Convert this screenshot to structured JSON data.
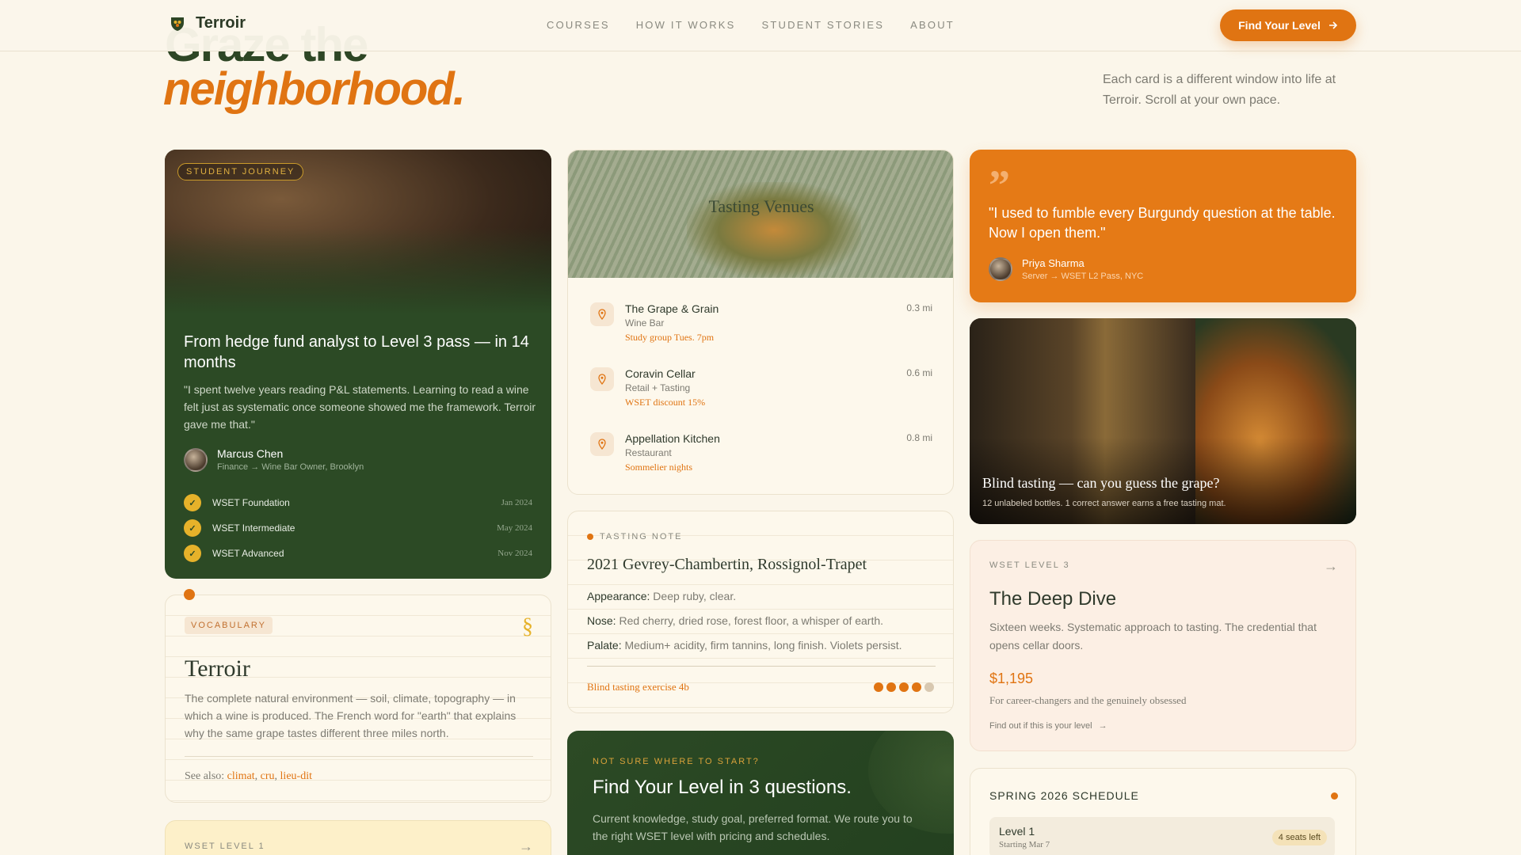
{
  "nav": {
    "brand": "Terroir",
    "links": [
      "COURSES",
      "HOW IT WORKS",
      "STUDENT STORIES",
      "ABOUT"
    ],
    "cta": "Find Your Level"
  },
  "hero": {
    "line1": "Graze the",
    "line2": "neighborhood.",
    "description": "Each card is a different window into life at Terroir. Scroll at your own pace."
  },
  "journey": {
    "badge": "STUDENT JOURNEY",
    "title": "From hedge fund analyst to Level 3 pass — in 14 months",
    "quote": "\"I spent twelve years reading P&L statements. Learning to read a wine felt just as systematic once someone showed me the framework. Terroir gave me that.\"",
    "person_name": "Marcus Chen",
    "person_role": "Finance → Wine Bar Owner, Brooklyn",
    "milestones": [
      {
        "label": "WSET Foundation",
        "date": "Jan 2024"
      },
      {
        "label": "WSET Intermediate",
        "date": "May 2024"
      },
      {
        "label": "WSET Advanced",
        "date": "Nov 2024"
      }
    ]
  },
  "venues": {
    "title": "Tasting Venues",
    "items": [
      {
        "name": "The Grape & Grain",
        "type": "Wine Bar",
        "note": "Study group Tues. 7pm",
        "distance": "0.3 mi"
      },
      {
        "name": "Coravin Cellar",
        "type": "Retail + Tasting",
        "note": "WSET discount 15%",
        "distance": "0.6 mi"
      },
      {
        "name": "Appellation Kitchen",
        "type": "Restaurant",
        "note": "Sommelier nights",
        "distance": "0.8 mi"
      }
    ]
  },
  "quote_card": {
    "mark": "”",
    "text": "\"I used to fumble every Burgundy question at the table. Now I open them.\"",
    "person_name": "Priya Sharma",
    "person_role": "Server → WSET L2 Pass, NYC"
  },
  "blind": {
    "title": "Blind tasting — can you guess the grape?",
    "subtitle": "12 unlabeled bottles. 1 correct answer earns a free tasting mat."
  },
  "vocab": {
    "badge": "VOCABULARY",
    "mark": "§",
    "word": "Terroir",
    "definition": "The complete natural environment — soil, climate, topography — in which a wine is produced. The French word for \"earth\" that explains why the same grape tastes different three miles north.",
    "see_also_label": "See also:",
    "see_also": [
      "climat",
      "cru",
      "lieu-dit"
    ]
  },
  "note": {
    "eyebrow": "TASTING NOTE",
    "wine": "2021 Gevrey-Chambertin, Rossignol-Trapet",
    "appearance_label": "Appearance:",
    "appearance": "Deep ruby, clear.",
    "nose_label": "Nose:",
    "nose": "Red cherry, dried rose, forest floor, a whisper of earth.",
    "palate_label": "Palate:",
    "palate": "Medium+ acidity, firm tannins, long finish. Violets persist.",
    "exercise": "Blind tasting exercise 4b",
    "rating": 4,
    "rating_max": 5
  },
  "find": {
    "eyebrow": "NOT SURE WHERE TO START?",
    "title": "Find Your Level in 3 questions.",
    "description": "Current knowledge, study goal, preferred format. We route you to the right WSET level with pricing and schedules."
  },
  "wset3": {
    "eyebrow": "WSET LEVEL 3",
    "title": "The Deep Dive",
    "description": "Sixteen weeks. Systematic approach to tasting. The credential that opens cellar doors.",
    "price": "$1,195",
    "audience": "For career-changers and the genuinely obsessed",
    "link": "Find out if this is your level"
  },
  "schedule": {
    "title": "SPRING 2026 SCHEDULE",
    "rows": [
      {
        "level": "Level 1",
        "start": "Starting Mar 7",
        "seats": "4 seats left"
      }
    ]
  },
  "wset1": {
    "eyebrow": "WSET LEVEL 1"
  },
  "colors": {
    "background": "#fbf6ea",
    "accent": "#e07412",
    "forest": "#2c4a25",
    "gold": "#e6b22a"
  },
  "icons": {
    "brand": "grape-shield-icon",
    "arrow": "arrow-right-icon",
    "pin": "map-pin-icon",
    "check": "check-icon"
  }
}
